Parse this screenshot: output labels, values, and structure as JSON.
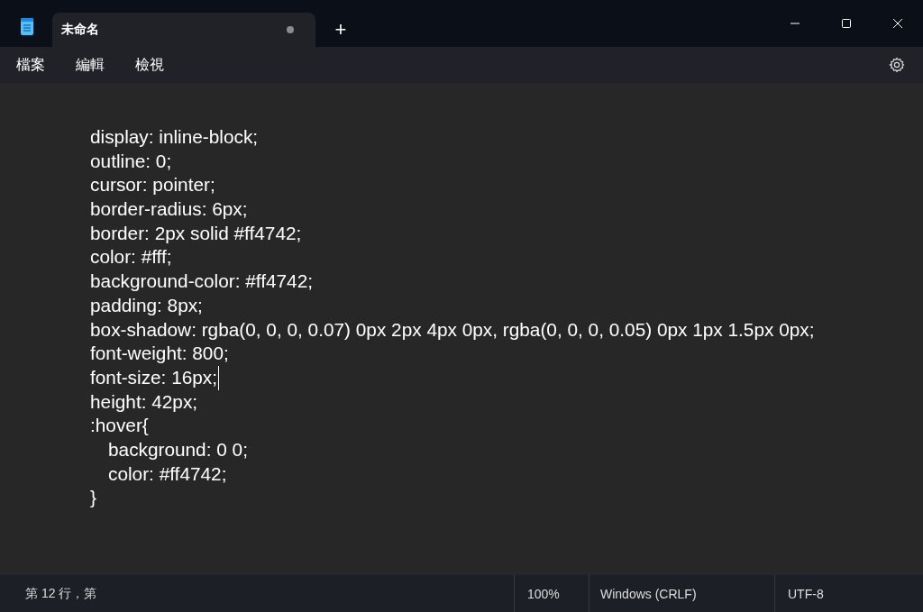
{
  "tab": {
    "title": "未命名",
    "modified": true
  },
  "new_tab_button": "+",
  "menu": [
    {
      "label": "檔案"
    },
    {
      "label": "編輯"
    },
    {
      "label": "檢視"
    }
  ],
  "editor": {
    "lines": [
      {
        "text": "display: inline-block;",
        "caret": false
      },
      {
        "text": "outline: 0;",
        "caret": false
      },
      {
        "text": "cursor: pointer;",
        "caret": false
      },
      {
        "text": "border-radius: 6px;",
        "caret": false
      },
      {
        "text": "border: 2px solid #ff4742;",
        "caret": false
      },
      {
        "text": "color: #fff;",
        "caret": false
      },
      {
        "text": "background-color: #ff4742;",
        "caret": false
      },
      {
        "text": "padding: 8px;",
        "caret": false
      },
      {
        "text": "box-shadow: rgba(0, 0, 0, 0.07) 0px 2px 4px 0px, rgba(0, 0, 0, 0.05) 0px 1px 1.5px 0px;",
        "caret": false
      },
      {
        "text": "font-weight: 800;",
        "caret": false
      },
      {
        "text": "font-size: 16px;",
        "caret": true
      },
      {
        "text": "height: 42px;",
        "caret": false
      },
      {
        "text": ":hover{",
        "caret": false,
        "children": [
          {
            "text": "background: 0 0;",
            "caret": false
          },
          {
            "text": "color: #ff4742;",
            "caret": false
          }
        ]
      },
      {
        "text": "}",
        "caret": false
      }
    ]
  },
  "status_bar": {
    "position": "第 12 行，第",
    "zoom": "100%",
    "line_ending": "Windows (CRLF)",
    "encoding": "UTF-8"
  }
}
